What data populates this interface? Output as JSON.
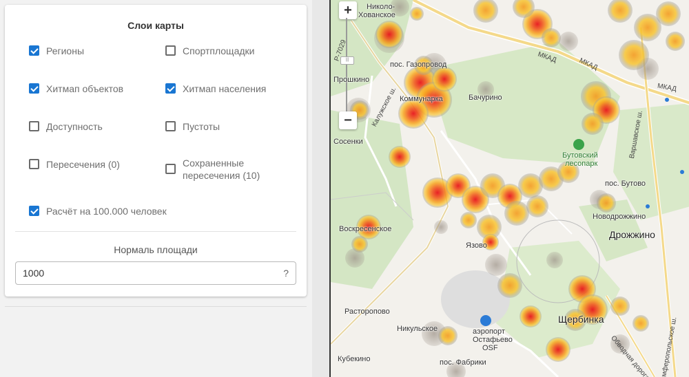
{
  "panel": {
    "title": "Слои карты",
    "layers": [
      {
        "label": "Регионы",
        "checked": true
      },
      {
        "label": "Спортплощадки",
        "checked": false
      },
      {
        "label": "Хитмап объектов",
        "checked": true
      },
      {
        "label": "Хитмап населения",
        "checked": true
      },
      {
        "label": "Доступность",
        "checked": false
      },
      {
        "label": "Пустоты",
        "checked": false
      },
      {
        "label": "Пересечения (0)",
        "checked": false
      },
      {
        "label": "Сохраненные пересечения (10)",
        "checked": false
      },
      {
        "label": "Расчёт на 100.000 человек",
        "checked": true
      }
    ],
    "normal_area_label": "Нормаль площади",
    "normal_area_value": "1000",
    "help_glyph": "?"
  },
  "map": {
    "zoom_in": "+",
    "zoom_out": "−",
    "labels": {
      "nikolo": "Николо-",
      "khovanskoe": "Хованское",
      "gazoprovod": "пос. Газопровод",
      "proshkino": "Прошкино",
      "kommunarka": "Коммунарка",
      "bachurino": "Бачурино",
      "sosenki": "Сосенки",
      "butovsky": "Бутовский",
      "lesopark": "лесопарк",
      "pos_butovo": "пос. Бутово",
      "novodrozhzhino": "Новодрожжино",
      "drozhzhino": "Дрожжино",
      "voskresenskoe": "Воскресенское",
      "yazovo": "Язово",
      "rastoropovo": "Расторопово",
      "nikulskoe": "Никульское",
      "aeroport": "аэропорт",
      "ostafyevo": "Остафьево",
      "osf": "OSF",
      "shcherbinka": "Щербинка",
      "kubekino": "Кубекино",
      "pos_fabriki": "пос. Фабрики",
      "mkad1": "МКАД",
      "mkad2": "МКАД",
      "mkad3": "МКАД",
      "kaluzhskoe": "Калужское ш.",
      "varshavskoe": "Варшавское ш.",
      "simferopolskoe": "Симферопольское ш.",
      "obvodnaya": "Обводная дорога",
      "r7029": "Р-7029"
    }
  }
}
